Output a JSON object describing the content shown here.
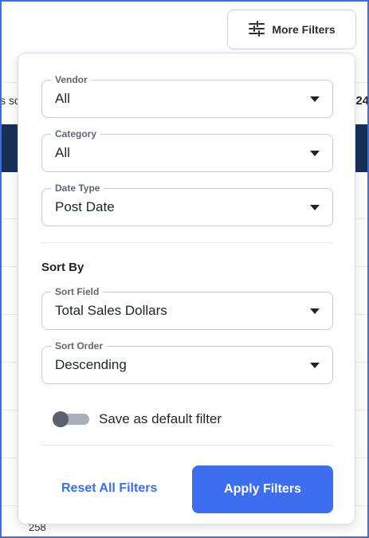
{
  "background": {
    "left_text": "s sc",
    "right_text": "24",
    "bottom_number": "258"
  },
  "toolbar": {
    "more_filters_label": "More Filters",
    "more_filters_icon": "sliders-icon"
  },
  "filters": {
    "vendor": {
      "label": "Vendor",
      "value": "All"
    },
    "category": {
      "label": "Category",
      "value": "All"
    },
    "date_type": {
      "label": "Date Type",
      "value": "Post Date"
    }
  },
  "sort": {
    "heading": "Sort By",
    "field": {
      "label": "Sort Field",
      "value": "Total Sales Dollars"
    },
    "order": {
      "label": "Sort Order",
      "value": "Descending"
    }
  },
  "default_toggle": {
    "label": "Save as default filter",
    "checked": false
  },
  "actions": {
    "reset_label": "Reset All Filters",
    "apply_label": "Apply Filters"
  },
  "colors": {
    "accent": "#3d6ef0",
    "link": "#3b6fe8",
    "navy": "#17305a",
    "frame": "#3b6fdc"
  }
}
